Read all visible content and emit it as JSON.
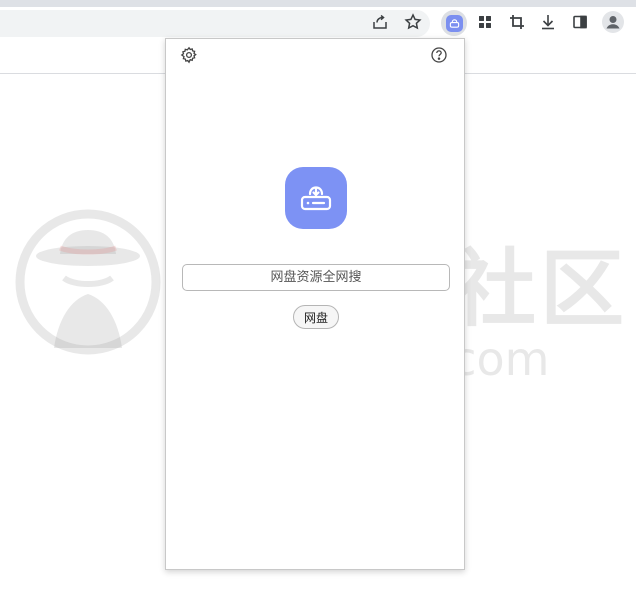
{
  "popup": {
    "search": {
      "placeholder": "网盘资源全网搜",
      "value": ""
    },
    "search_button_label": "网盘"
  },
  "watermark": {
    "text": "哈综合社区",
    "url": "www.i3zh.com"
  },
  "icons": {
    "toolbar": [
      "share-icon",
      "star-icon",
      "extension-netdisk-icon",
      "extensions-puzzle-icon",
      "crop-icon",
      "download-icon",
      "side-panel-icon",
      "profile-icon"
    ],
    "popup": [
      "settings-gear-icon",
      "help-icon",
      "cloud-drive-logo-icon"
    ]
  },
  "colors": {
    "accent": "#7d92f4",
    "toolbar_bg": "#f1f3f4"
  }
}
